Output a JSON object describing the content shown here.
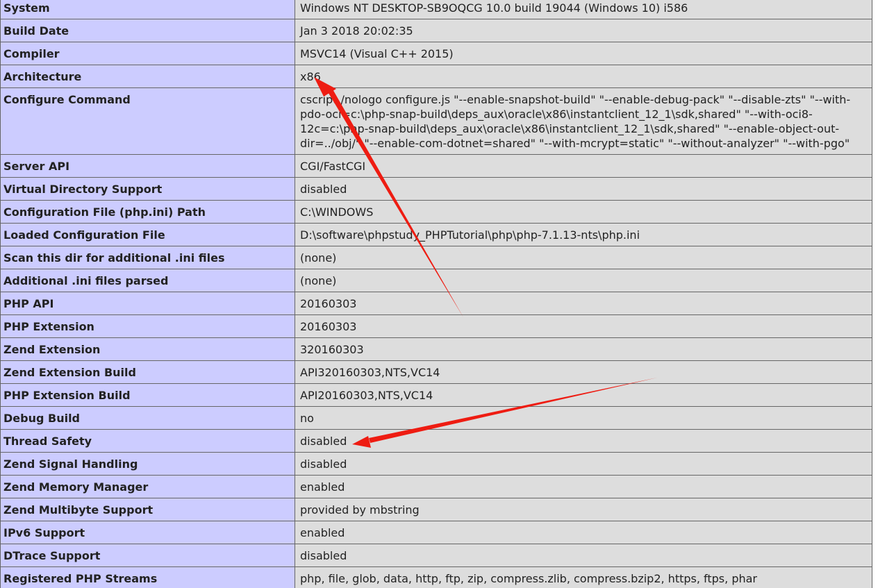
{
  "rows": [
    {
      "name": "System",
      "value": "Windows NT DESKTOP-SB9OQCG 10.0 build 19044 (Windows 10) i586"
    },
    {
      "name": "Build Date",
      "value": "Jan 3 2018 20:02:35"
    },
    {
      "name": "Compiler",
      "value": "MSVC14 (Visual C++ 2015)"
    },
    {
      "name": "Architecture",
      "value": "x86"
    },
    {
      "name": "Configure Command",
      "value": "cscript /nologo configure.js \"--enable-snapshot-build\" \"--enable-debug-pack\" \"--disable-zts\" \"--with-pdo-oci=c:\\php-snap-build\\deps_aux\\oracle\\x86\\instantclient_12_1\\sdk,shared\" \"--with-oci8-12c=c:\\php-snap-build\\deps_aux\\oracle\\x86\\instantclient_12_1\\sdk,shared\" \"--enable-object-out-dir=../obj/\" \"--enable-com-dotnet=shared\" \"--with-mcrypt=static\" \"--without-analyzer\" \"--with-pgo\""
    },
    {
      "name": "Server API",
      "value": "CGI/FastCGI"
    },
    {
      "name": "Virtual Directory Support",
      "value": "disabled"
    },
    {
      "name": "Configuration File (php.ini) Path",
      "value": "C:\\WINDOWS"
    },
    {
      "name": "Loaded Configuration File",
      "value": "D:\\software\\phpstudy_PHPTutorial\\php\\php-7.1.13-nts\\php.ini"
    },
    {
      "name": "Scan this dir for additional .ini files",
      "value": "(none)"
    },
    {
      "name": "Additional .ini files parsed",
      "value": "(none)"
    },
    {
      "name": "PHP API",
      "value": "20160303"
    },
    {
      "name": "PHP Extension",
      "value": "20160303"
    },
    {
      "name": "Zend Extension",
      "value": "320160303"
    },
    {
      "name": "Zend Extension Build",
      "value": "API320160303,NTS,VC14"
    },
    {
      "name": "PHP Extension Build",
      "value": "API20160303,NTS,VC14"
    },
    {
      "name": "Debug Build",
      "value": "no"
    },
    {
      "name": "Thread Safety",
      "value": "disabled"
    },
    {
      "name": "Zend Signal Handling",
      "value": "disabled"
    },
    {
      "name": "Zend Memory Manager",
      "value": "enabled"
    },
    {
      "name": "Zend Multibyte Support",
      "value": "provided by mbstring"
    },
    {
      "name": "IPv6 Support",
      "value": "enabled"
    },
    {
      "name": "DTrace Support",
      "value": "disabled"
    },
    {
      "name": "Registered PHP Streams",
      "value": "php, file, glob, data, http, ftp, zip, compress.zlib, compress.bzip2, https, ftps, phar"
    }
  ],
  "colors": {
    "label_bg": "#ccccff",
    "value_bg": "#dddddd",
    "border": "#666666",
    "annotation_arrow": "#ee1c12"
  }
}
